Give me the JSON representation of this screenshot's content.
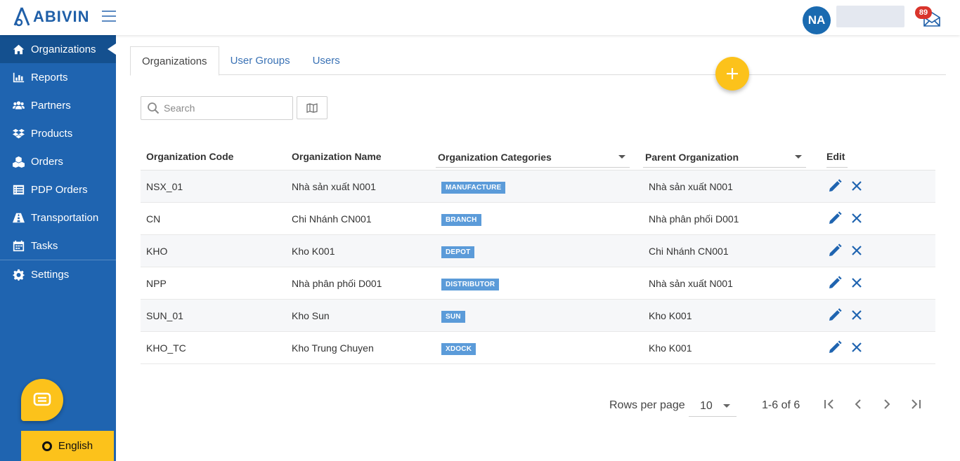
{
  "app": {
    "logo_text": "ABIVIN",
    "brand_color": "#1f64b0",
    "accent_color": "#fcc21b"
  },
  "header": {
    "avatar_initials": "NA",
    "notification_count": "89"
  },
  "sidebar": {
    "items": [
      {
        "label": "Organizations",
        "icon": "home-icon"
      },
      {
        "label": "Reports",
        "icon": "bar-chart-icon"
      },
      {
        "label": "Partners",
        "icon": "users-icon"
      },
      {
        "label": "Products",
        "icon": "dropbox-icon"
      },
      {
        "label": "Orders",
        "icon": "cubes-icon"
      },
      {
        "label": "PDP Orders",
        "icon": "list-icon"
      },
      {
        "label": "Transportation",
        "icon": "road-icon"
      },
      {
        "label": "Tasks",
        "icon": "calendar-icon"
      },
      {
        "label": "Settings",
        "icon": "gear-icon"
      }
    ],
    "language_label": "English"
  },
  "tabs": [
    {
      "label": "Organizations",
      "active": true
    },
    {
      "label": "User Groups",
      "active": false
    },
    {
      "label": "Users",
      "active": false
    }
  ],
  "search": {
    "placeholder": "Search"
  },
  "table": {
    "columns": {
      "code": "Organization Code",
      "name": "Organization Name",
      "categories": "Organization Categories",
      "parent": "Parent Organization",
      "edit": "Edit"
    },
    "rows": [
      {
        "code": "NSX_01",
        "name": "Nhà sản xuất N001",
        "category": "MANUFACTURE",
        "parent": "Nhà sản xuất N001"
      },
      {
        "code": "CN",
        "name": "Chi Nhánh CN001",
        "category": "BRANCH",
        "parent": "Nhà phân phối D001"
      },
      {
        "code": "KHO",
        "name": "Kho K001",
        "category": "DEPOT",
        "parent": "Chi Nhánh CN001"
      },
      {
        "code": "NPP",
        "name": "Nhà phân phối D001",
        "category": "DISTRIBUTOR",
        "parent": "Nhà sản xuất N001"
      },
      {
        "code": "SUN_01",
        "name": "Kho Sun",
        "category": "SUN",
        "parent": "Kho K001"
      },
      {
        "code": "KHO_TC",
        "name": "Kho Trung Chuyen",
        "category": "XDOCK",
        "parent": "Kho K001"
      }
    ]
  },
  "pagination": {
    "rows_per_page_label": "Rows per page",
    "rows_per_page_value": "10",
    "range": "1-6 of 6"
  }
}
